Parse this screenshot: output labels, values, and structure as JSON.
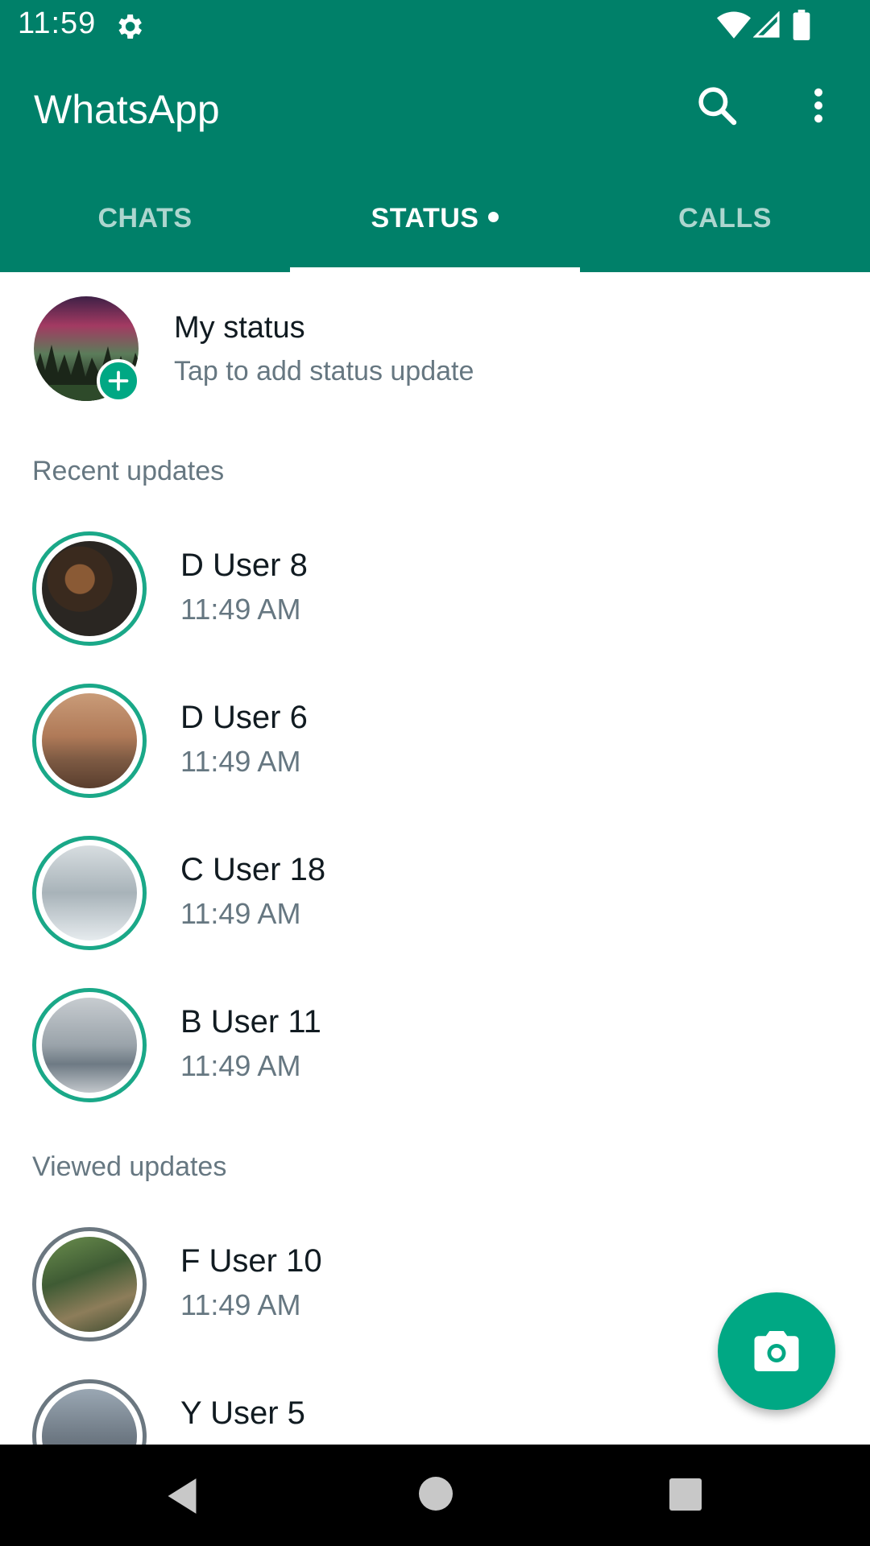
{
  "status_bar": {
    "time": "11:59",
    "icons": [
      "gear-icon",
      "wifi-icon",
      "signal-icon",
      "battery-icon"
    ]
  },
  "app_bar": {
    "title": "WhatsApp",
    "actions": [
      "search-icon",
      "more-vert-icon"
    ]
  },
  "tabs": [
    {
      "label": "CHATS",
      "active": false
    },
    {
      "label": "STATUS",
      "active": true,
      "has_dot": true
    },
    {
      "label": "CALLS",
      "active": false
    }
  ],
  "my_status": {
    "name": "My status",
    "subtitle": "Tap to add status update"
  },
  "sections": {
    "recent_label": "Recent updates",
    "viewed_label": "Viewed updates"
  },
  "recent_updates": [
    {
      "name": "D User 8",
      "time": "11:49 AM"
    },
    {
      "name": "D User 6",
      "time": "11:49 AM"
    },
    {
      "name": "C User 18",
      "time": "11:49 AM"
    },
    {
      "name": "B User 11",
      "time": "11:49 AM"
    }
  ],
  "viewed_updates": [
    {
      "name": "F User 10",
      "time": "11:49 AM"
    },
    {
      "name": "Y User 5",
      "time": ""
    }
  ],
  "fab": {
    "icon": "camera-icon"
  },
  "colors": {
    "primary": "#008069",
    "accent": "#00a884",
    "ring_recent": "#1aa888",
    "ring_viewed": "#6b7780",
    "text_primary": "#111b21",
    "text_secondary": "#667781"
  }
}
